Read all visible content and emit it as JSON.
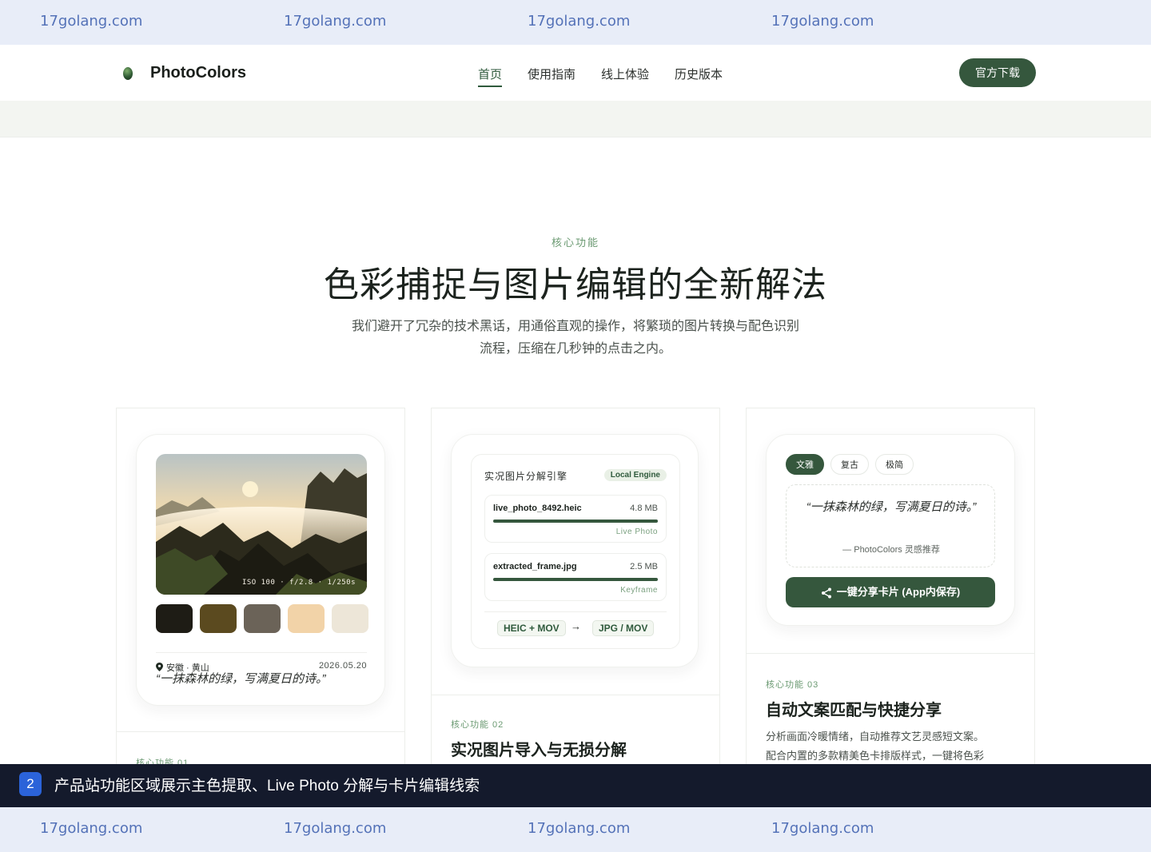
{
  "watermark": {
    "text": "17golang.com"
  },
  "nav": {
    "logo_text": "PhotoColors",
    "links": [
      "首页",
      "使用指南",
      "线上体验",
      "历史版本"
    ],
    "active_index": 0,
    "download_label": "官方下载"
  },
  "section": {
    "kicker": "核心功能",
    "title": "色彩捕捉与图片编辑的全新解法",
    "desc_line1": "我们避开了冗杂的技术黑话，用通俗直观的操作，将繁琐的图片转换与配色识别",
    "desc_line2": "流程，压缩在几秒钟的点击之内。"
  },
  "card1": {
    "exif": "ISO 100 · f/2.8 · 1/250s",
    "swatches": [
      "#1e1c15",
      "#5b4a1f",
      "#6b6358",
      "#f2d3a8",
      "#ede6d8"
    ],
    "location": "安徽 · 黄山",
    "date": "2026.05.20",
    "quote": "“一抹森林的绿，写满夏日的诗。”",
    "feature_kicker": "核心功能 01"
  },
  "card2": {
    "panel_title": "实况图片分解引擎",
    "engine_badge": "Local Engine",
    "files": [
      {
        "name": "live_photo_8492.heic",
        "size": "4.8 MB",
        "tag": "Live Photo",
        "progress": 1.0
      },
      {
        "name": "extracted_frame.jpg",
        "size": "2.5 MB",
        "tag": "Keyframe",
        "progress": 1.0
      }
    ],
    "format_from": "HEIC + MOV",
    "format_arrow": "→",
    "format_to": "JPG / MOV",
    "feature_kicker": "核心功能 02",
    "feature_title": "实况图片导入与无损分解"
  },
  "card3": {
    "tabs": [
      "文雅",
      "复古",
      "极简"
    ],
    "active_tab": 0,
    "quote": "“一抹森林的绿，写满夏日的诗。”",
    "attribution": "— PhotoColors 灵感推荐",
    "share_label": "一键分享卡片 (App内保存)",
    "feature_kicker": "核心功能 03",
    "feature_title": "自动文案匹配与快捷分享",
    "feature_desc_line1": "分析画面冷暖情绪，自动推荐文艺灵感短文案。",
    "feature_desc_line2": "配合内置的多款精美色卡排版样式，一键将色彩"
  },
  "caption": {
    "number": "2",
    "text": "产品站功能区域展示主色提取、Live Photo 分解与卡片编辑线索"
  },
  "colors": {
    "brand_green": "#35573d",
    "accent_green": "#6b9a72",
    "caption_bg": "#141a2c",
    "caption_badge": "#2b63d9",
    "watermark_bg": "#e8edf8"
  }
}
